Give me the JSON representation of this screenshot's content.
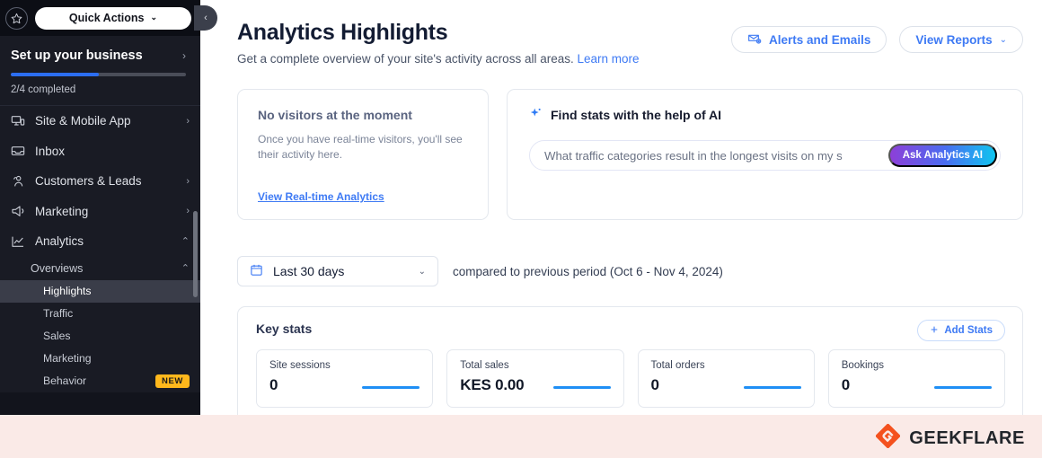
{
  "sidebar": {
    "star_icon": "star-icon",
    "quick_actions": {
      "label": "Quick Actions",
      "chevron": "⌄"
    },
    "setup": {
      "title": "Set up your business",
      "chevron": "›",
      "progress_label": "2/4 completed",
      "progress_percent": 50,
      "progress_color": "#2c6ef2"
    },
    "nav": [
      {
        "label": "Site & Mobile App",
        "icon": "monitor-mobile-icon",
        "chevron": "›"
      },
      {
        "label": "Inbox",
        "icon": "inbox-icon",
        "chevron": ""
      },
      {
        "label": "Customers & Leads",
        "icon": "people-icon",
        "chevron": "›"
      },
      {
        "label": "Marketing",
        "icon": "megaphone-icon",
        "chevron": "›"
      },
      {
        "label": "Analytics",
        "icon": "line-chart-icon",
        "chevron": "⌃"
      }
    ],
    "sub_group": {
      "label": "Overviews",
      "chevron": "⌃"
    },
    "sub_items": [
      {
        "label": "Highlights",
        "active": true,
        "badge": ""
      },
      {
        "label": "Traffic",
        "active": false,
        "badge": ""
      },
      {
        "label": "Sales",
        "active": false,
        "badge": ""
      },
      {
        "label": "Marketing",
        "active": false,
        "badge": ""
      },
      {
        "label": "Behavior",
        "active": false,
        "badge": "NEW"
      }
    ],
    "collapse_chevron": "‹"
  },
  "header": {
    "title": "Analytics Highlights",
    "subtitle": "Get a complete overview of your site's activity across all areas.",
    "learn_more": "Learn more",
    "alerts_button": "Alerts and Emails",
    "reports_button": "View Reports",
    "reports_chevron": "⌄"
  },
  "realtime_card": {
    "title": "No visitors at the moment",
    "description": "Once you have real-time visitors, you'll see their activity here.",
    "link": "View Real-time Analytics"
  },
  "ai_card": {
    "heading": "Find stats with the help of AI",
    "sparkle_icon": "sparkle-icon",
    "input_value": "What traffic categories result in the longest visits on my s",
    "input_placeholder": "What traffic categories result in the longest visits on my s",
    "ask_button": "Ask Analytics AI",
    "gradient_start": "#8d3fd8",
    "gradient_end": "#0fc5ef"
  },
  "date_range": {
    "calendar_icon": "calendar-icon",
    "selected": "Last 30 days",
    "chevron": "⌄",
    "comparison_note": "compared to previous period (Oct 6 - Nov 4, 2024)"
  },
  "key_stats": {
    "title": "Key stats",
    "add_button": "Add Stats",
    "plus_icon": "plus-icon",
    "cards": [
      {
        "label": "Site sessions",
        "value": "0"
      },
      {
        "label": "Total sales",
        "value": "KES 0.00"
      },
      {
        "label": "Total orders",
        "value": "0"
      },
      {
        "label": "Bookings",
        "value": "0"
      }
    ],
    "spark_color": "#1f8ff5"
  },
  "footer": {
    "brand": "GEEKFLARE",
    "logo_icon": "geekflare-logo-icon",
    "bar_color": "#faeae7",
    "logo_color": "#f4511e"
  }
}
